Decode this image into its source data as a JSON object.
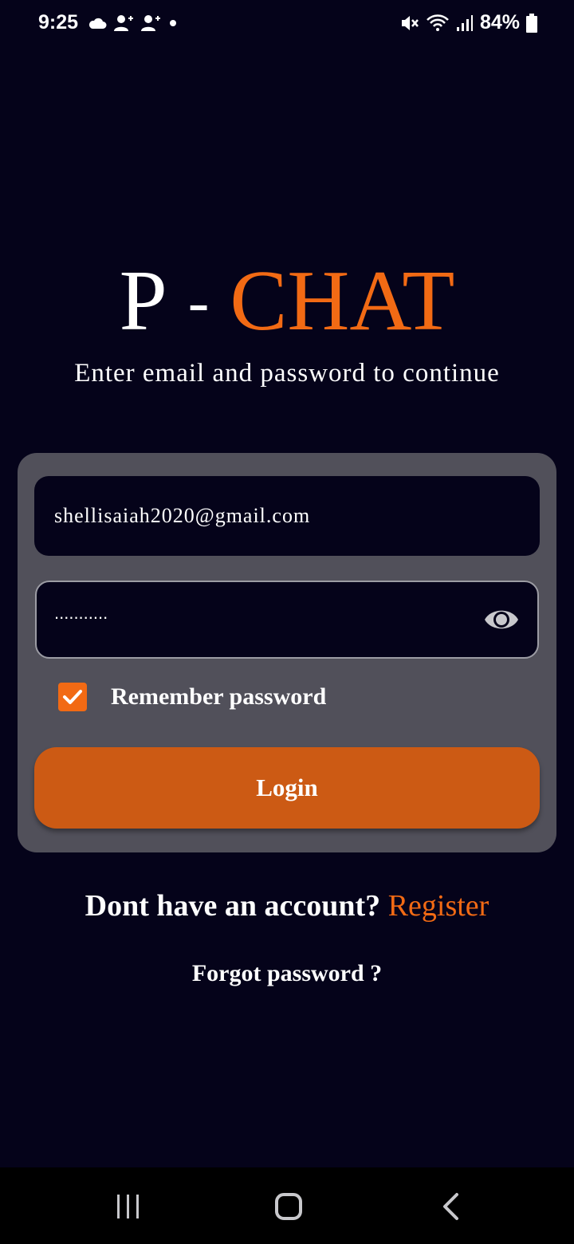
{
  "status_bar": {
    "time": "9:25",
    "battery": "84%",
    "icons_left": [
      "cloud-icon",
      "person-add-icon",
      "person-add-icon",
      "dot-icon"
    ],
    "icons_right": [
      "mute-icon",
      "wifi-icon",
      "signal-icon",
      "battery-icon"
    ]
  },
  "app": {
    "title_part1": "P",
    "title_dash": "-",
    "title_part2": "CHAT",
    "subtitle": "Enter email and password to continue",
    "accent_color": "#f26a14"
  },
  "form": {
    "email_value": "shellisaiah2020@gmail.com",
    "password_value": "...........",
    "remember_label": "Remember password",
    "remember_checked": true,
    "login_label": "Login"
  },
  "links": {
    "register_prompt": "Dont have an account?",
    "register_label": "Register",
    "forgot_label": "Forgot password ?"
  },
  "nav": {
    "items": [
      "recents-icon",
      "home-icon",
      "back-icon"
    ]
  }
}
